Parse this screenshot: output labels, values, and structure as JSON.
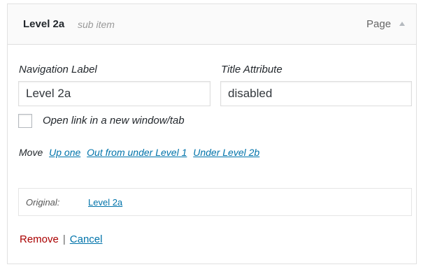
{
  "menu_item": {
    "title": "Level 2a",
    "subtitle": "sub item",
    "type": "Page",
    "toggle_icon": "up-arrow-icon"
  },
  "fields": {
    "nav_label": {
      "label": "Navigation Label",
      "value": "Level 2a"
    },
    "title_attr": {
      "label": "Title Attribute",
      "value": "disabled"
    }
  },
  "new_window": {
    "label": "Open link in a new window/tab",
    "checked": false
  },
  "move": {
    "label": "Move",
    "links": [
      "Up one",
      "Out from under Level 1",
      "Under Level 2b"
    ]
  },
  "original": {
    "label": "Original:",
    "link": "Level 2a"
  },
  "actions": {
    "remove": "Remove",
    "separator": "|",
    "cancel": "Cancel"
  },
  "colors": {
    "link": "#0073aa",
    "remove": "#aa0000",
    "header_bg": "#fafafa"
  }
}
